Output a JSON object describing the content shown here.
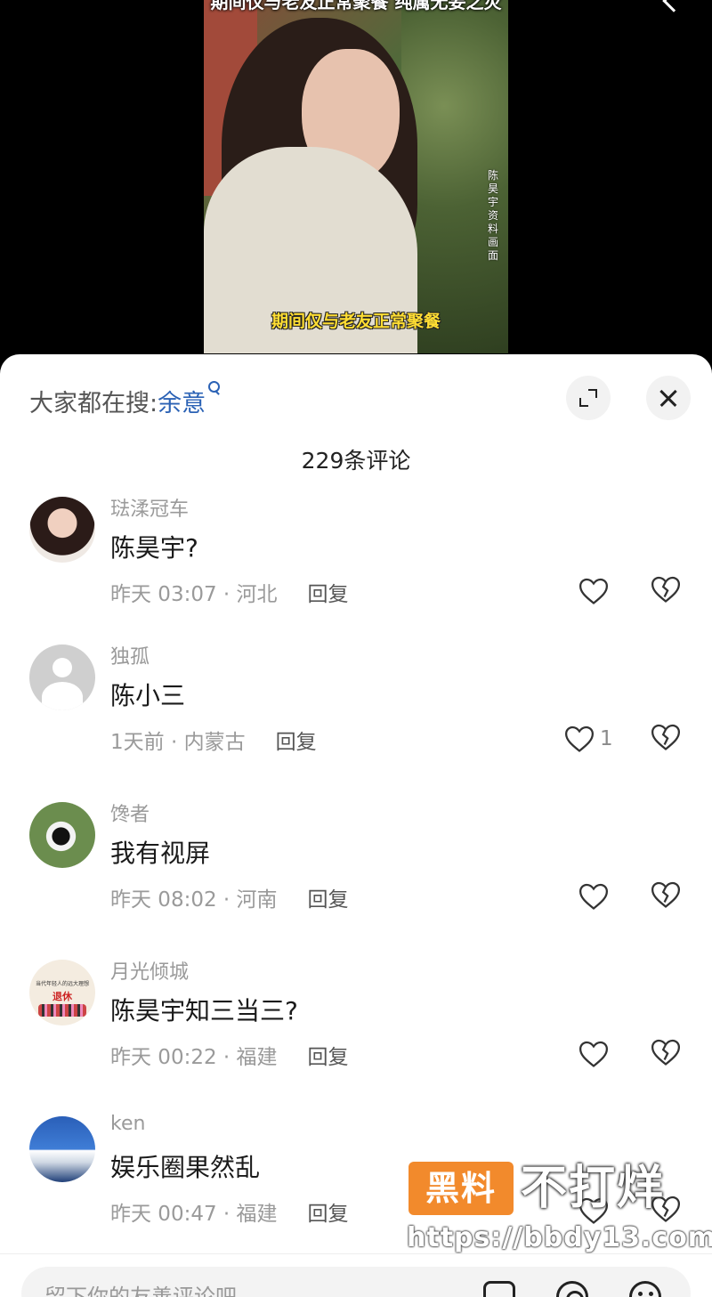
{
  "video": {
    "top_caption": "期间仅与老友正常聚餐 纯属无妄之灾",
    "vertical_caption": "陈昊宇资料画面",
    "subtitle": "期间仅与老友正常聚餐"
  },
  "sheet": {
    "search_prefix": "大家都在搜:",
    "search_term": "余意",
    "comment_count": "229条评论",
    "reply_label": "回复",
    "input_placeholder": "留下你的友善评论吧"
  },
  "comments": [
    {
      "username": "琺渘冠车",
      "text": "陈昊宇?",
      "meta": "昨天 03:07 · 河北",
      "likes": ""
    },
    {
      "username": "独孤",
      "text": "陈小三",
      "meta": "1天前 · 内蒙古",
      "likes": "1"
    },
    {
      "username": "馋者",
      "text": "我有视屏",
      "meta": "昨天 08:02 · 河南",
      "likes": ""
    },
    {
      "username": "月光倾城",
      "text": "陈昊宇知三当三?",
      "meta": "昨天 00:22 · 福建",
      "likes": ""
    },
    {
      "username": "ken",
      "text": "娱乐圈果然乱",
      "meta": "昨天 00:47 · 福建",
      "likes": ""
    }
  ],
  "avatar_texts": {
    "av4_line1": "当代年轻人的远大理想",
    "av4_line2": "退休"
  },
  "watermark": {
    "box": "黑料",
    "title": "不打烊",
    "url": "https://bbdy13.com"
  },
  "icons": {
    "expand": "expand-icon",
    "close": "close-icon",
    "like": "heart-outline-icon",
    "dislike": "broken-heart-icon",
    "image": "image-icon",
    "mention": "at-icon",
    "emoji": "emoji-icon"
  }
}
